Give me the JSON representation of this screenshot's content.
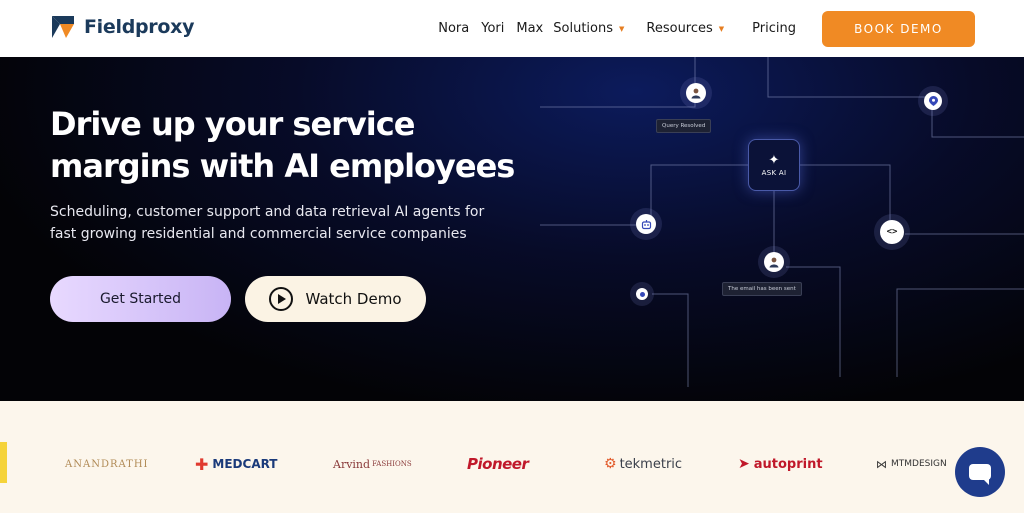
{
  "header": {
    "logo_text": "Fieldproxy",
    "nav": [
      {
        "label": "Nora"
      },
      {
        "label": "Yori"
      },
      {
        "label": "Max"
      },
      {
        "label": "Solutions"
      },
      {
        "label": "Resources"
      },
      {
        "label": "Pricing"
      }
    ],
    "cta_label": "BOOK DEMO"
  },
  "hero": {
    "title_line1": "Drive up your service",
    "title_line2": "margins with AI employees",
    "subtitle_line1": "Scheduling, customer support and data retrieval AI agents for",
    "subtitle_line2": "fast growing residential and commercial service companies",
    "get_started_label": "Get Started",
    "watch_demo_label": "Watch Demo",
    "graphic": {
      "ask_ai_label": "ASK AI",
      "tag_query": "Query Resolved",
      "tag_email": "The email has been sent"
    }
  },
  "logos": {
    "anand_rathi": "ANANDRATHI",
    "medcart": "MEDCART",
    "arvind": "Arvind",
    "arvind_suffix": "FASHIONS",
    "pioneer": "Pioneer",
    "tekmetric": "tekmetric",
    "autoprint": "autoprint",
    "mtm": "MTMDESIGN"
  },
  "colors": {
    "brand_navy": "#1b3a5b",
    "cta_orange": "#f08a24",
    "chat_blue": "#1f3c8c"
  }
}
